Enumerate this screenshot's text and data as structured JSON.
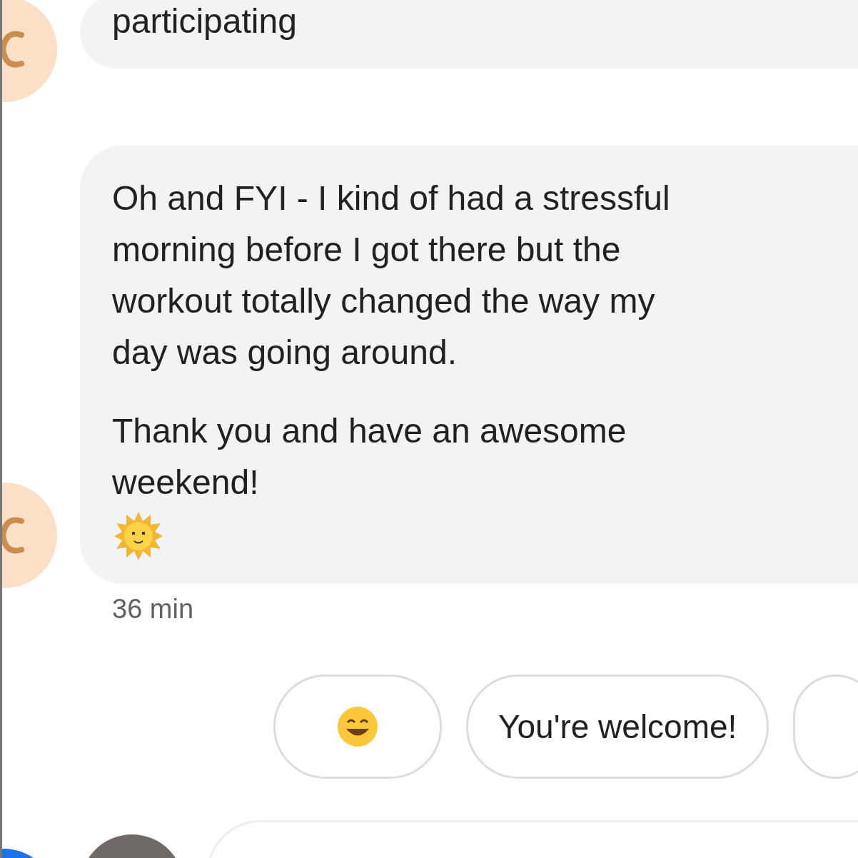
{
  "messages": [
    {
      "paragraphs": [
        "participating"
      ]
    },
    {
      "paragraphs": [
        "Oh and FYI - I kind of had a stressful\nmorning before I got there but the\nworkout totally changed the way my\nday was going around.",
        "Thank you and have an awesome\nweekend!"
      ],
      "emoji": true,
      "time": "36 min"
    }
  ],
  "smart_replies": [
    {
      "kind": "emoji"
    },
    {
      "kind": "text",
      "label": "You're welcome!"
    },
    {
      "kind": "text"
    }
  ]
}
